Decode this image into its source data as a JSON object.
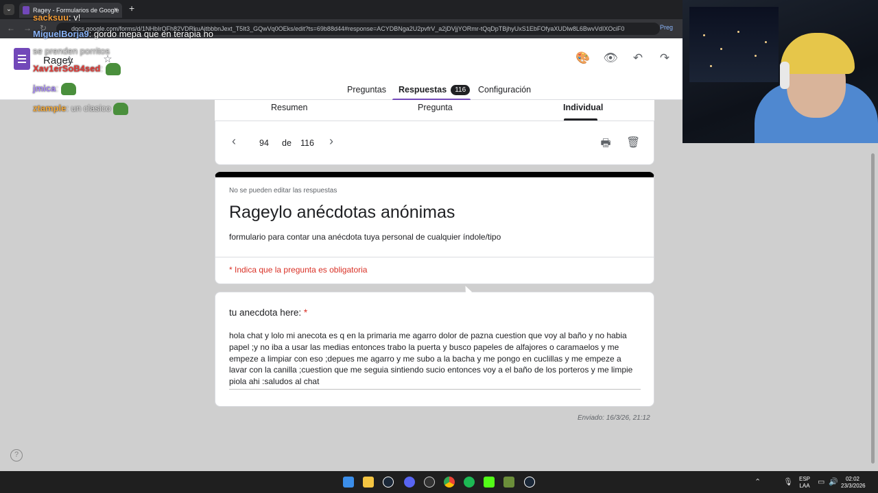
{
  "browser": {
    "tab_title": "Ragey - Formularios de Google",
    "tab_close": "×",
    "new_tab": "+",
    "url": "docs.google.com/forms/d/1NHbIrQFh82VDRkuAjtbbbnJext_T5It3_GQwVq0OEks/edit?ts=69b88d44#response=ACYDBNga2U2pvfrV_a2jDVjjYORmr-tQqDpTBjhyUxS1EbFOfyaXUDlw8L6BwvVdIXOciF0",
    "side_chip": "Preg"
  },
  "header": {
    "form_name": "Ragey",
    "icons": [
      "palette-icon",
      "eye-icon",
      "undo-icon",
      "redo-icon"
    ],
    "tabs": [
      {
        "label": "Preguntas"
      },
      {
        "label": "Respuestas",
        "count": "116"
      },
      {
        "label": "Configuración"
      }
    ]
  },
  "chat": [
    {
      "user": "MiguelBorja9",
      "message": ": gordo mepa que en terapia no"
    },
    {
      "user": "",
      "message": "se prenden porritos"
    },
    {
      "user": "Xav1erSoB4sed",
      "message": ":"
    },
    {
      "user": "jmica",
      "message": ":"
    },
    {
      "user": "ztample",
      "message": ": un clasico"
    },
    {
      "user": "sacksuu",
      "message": ": v!"
    }
  ],
  "subtabs": [
    {
      "label": "Resumen"
    },
    {
      "label": "Pregunta"
    },
    {
      "label": "Individual"
    }
  ],
  "pager": {
    "current": "94",
    "of_label": "de",
    "total": "116",
    "prev": "‹",
    "next": "›"
  },
  "form": {
    "note": "No se pueden editar las respuestas",
    "title": "Rageylo anécdotas anónimas",
    "description": "formulario para contar una anécdota tuya personal de cualquier índole/tipo",
    "required_note": "* Indica que la pregunta es obligatoria"
  },
  "question": {
    "label": "tu anecdota here:",
    "required_mark": "*",
    "answer": "hola chat y lolo mi anecota es q en la primaria me agarro dolor de pazna cuestion que voy al baño y no habia papel ;y no iba a usar las medias entonces trabo la puerta y busco papeles de alfajores o caramaelos y me empeze a limpiar con  eso ;depues me agarro y me subo a la bacha y me pongo en cuclillas y me empeze a lavar con la canilla ;cuestion que me seguia sintiendo sucio entonces voy  a el baño de los porteros y me limpie piola ahi :saludos al chat"
  },
  "submitted": "Enviado: 16/3/26, 21:12",
  "help": "?",
  "taskbar": {
    "lang_top": "ESP",
    "lang_bottom": "LAA",
    "time": "02:02",
    "date": "23/3/2026",
    "apps": [
      "windows-start-icon",
      "file-explorer-icon",
      "steam-icon",
      "discord-icon",
      "obs-icon",
      "chrome-icon",
      "spotify-icon",
      "kick-icon",
      "minecraft-icon",
      "steam-icon"
    ]
  },
  "colors": {
    "forms_purple": "#7248b9",
    "required_red": "#d93025",
    "chat_user": "#8ab4f8"
  }
}
